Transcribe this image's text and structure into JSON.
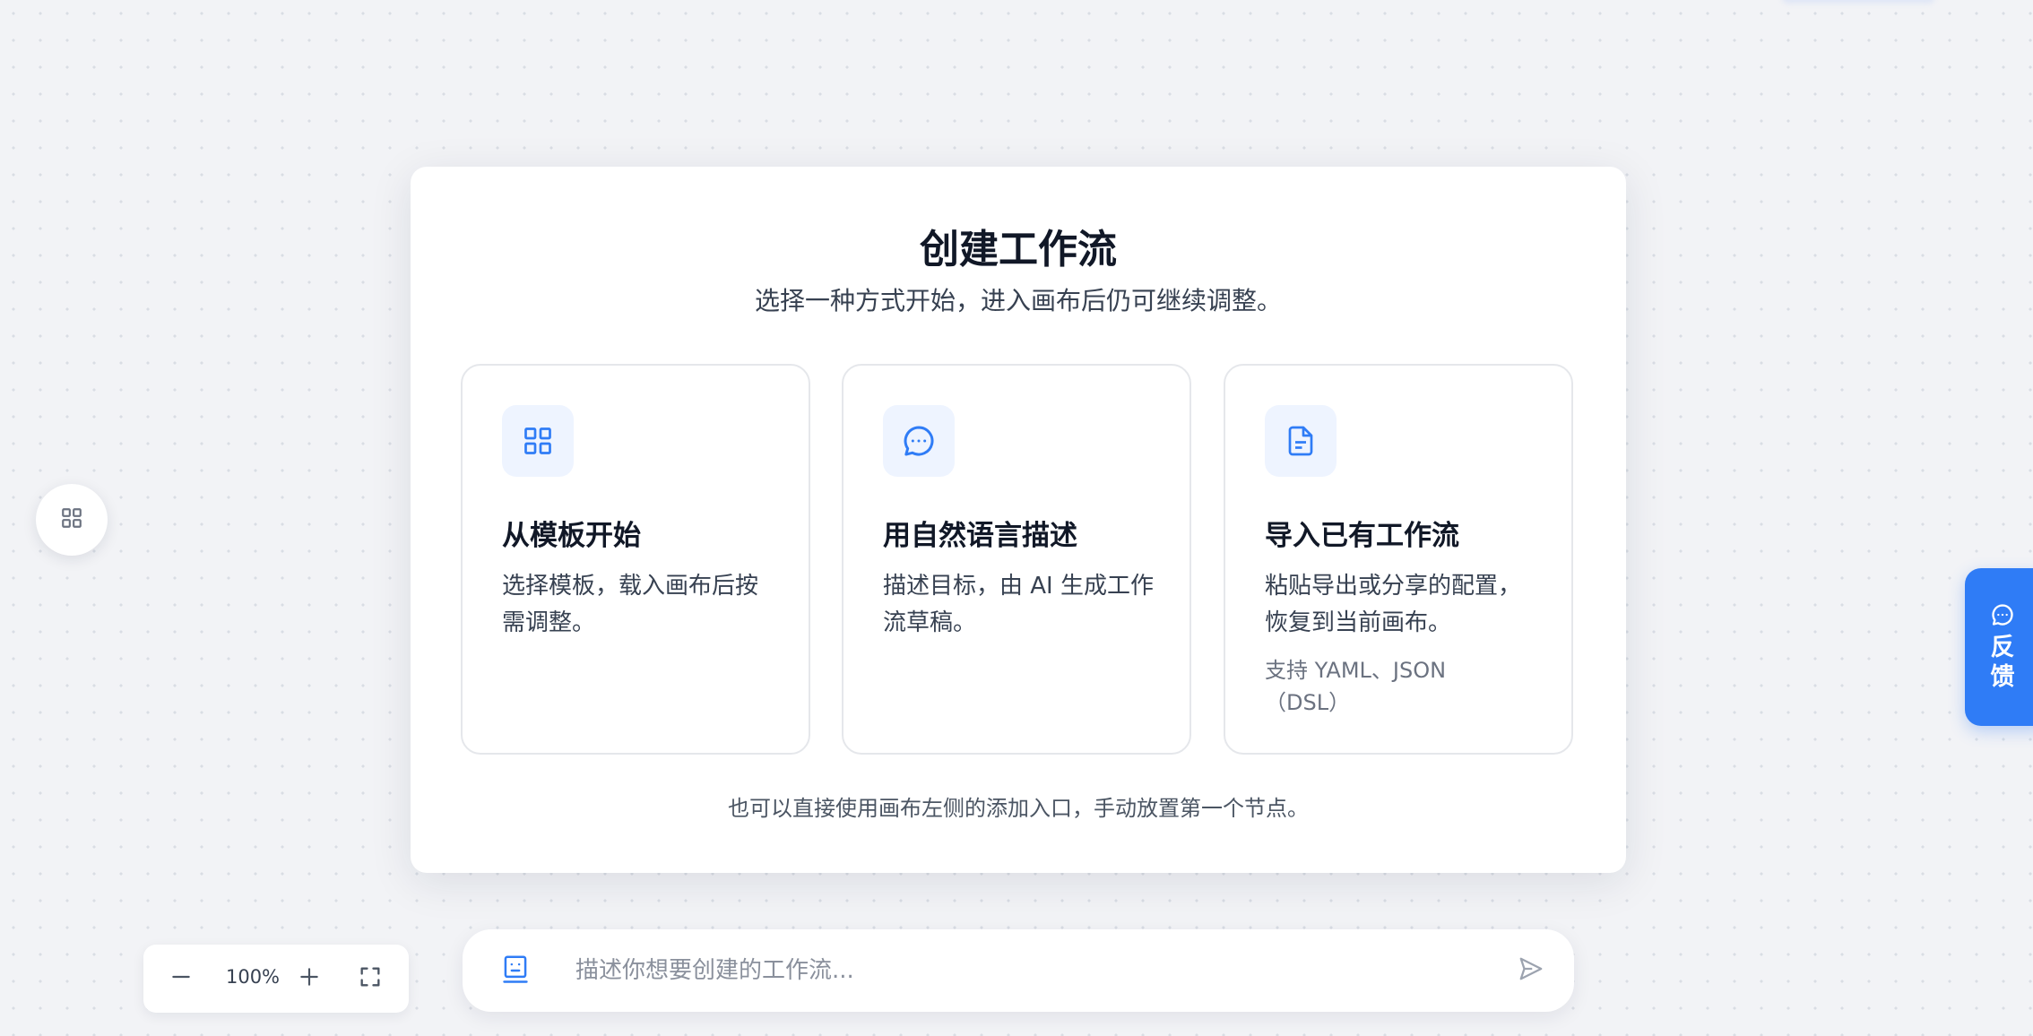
{
  "colors": {
    "accent": "#2f7cf6",
    "canvas_background": "#f2f3f6",
    "icon_tile_background": "#eef4ff",
    "title_text": "#111827",
    "body_text": "#374151",
    "muted_text": "#6b7280"
  },
  "canvas": {
    "left_handle_icon": "grid-icon"
  },
  "dialog": {
    "title": "创建工作流",
    "subtitle": "选择一种方式开始，进入画布后仍可继续调整。",
    "cards": [
      {
        "icon": "grid-icon",
        "title": "从模板开始",
        "description": "选择模板，载入画布后按需调整。"
      },
      {
        "icon": "chat-bubble-icon",
        "title": "用自然语言描述",
        "description": "描述目标，由 AI 生成工作流草稿。"
      },
      {
        "icon": "document-icon",
        "title": "导入已有工作流",
        "description": "粘贴导出或分享的配置，恢复到当前画布。",
        "note": "支持 YAML、JSON（DSL）"
      }
    ],
    "footer": "也可以直接使用画布左侧的添加入口，手动放置第一个节点。"
  },
  "feedback": {
    "icon": "chat-bubble-icon",
    "label": "反馈"
  },
  "zoom": {
    "level": "100%",
    "zoom_out_icon": "minus-icon",
    "zoom_in_icon": "plus-icon",
    "fit_icon": "fullscreen-icon"
  },
  "prompt": {
    "icon": "robot-icon",
    "value": "",
    "placeholder": "描述你想要创建的工作流...",
    "send_icon": "send-icon"
  }
}
